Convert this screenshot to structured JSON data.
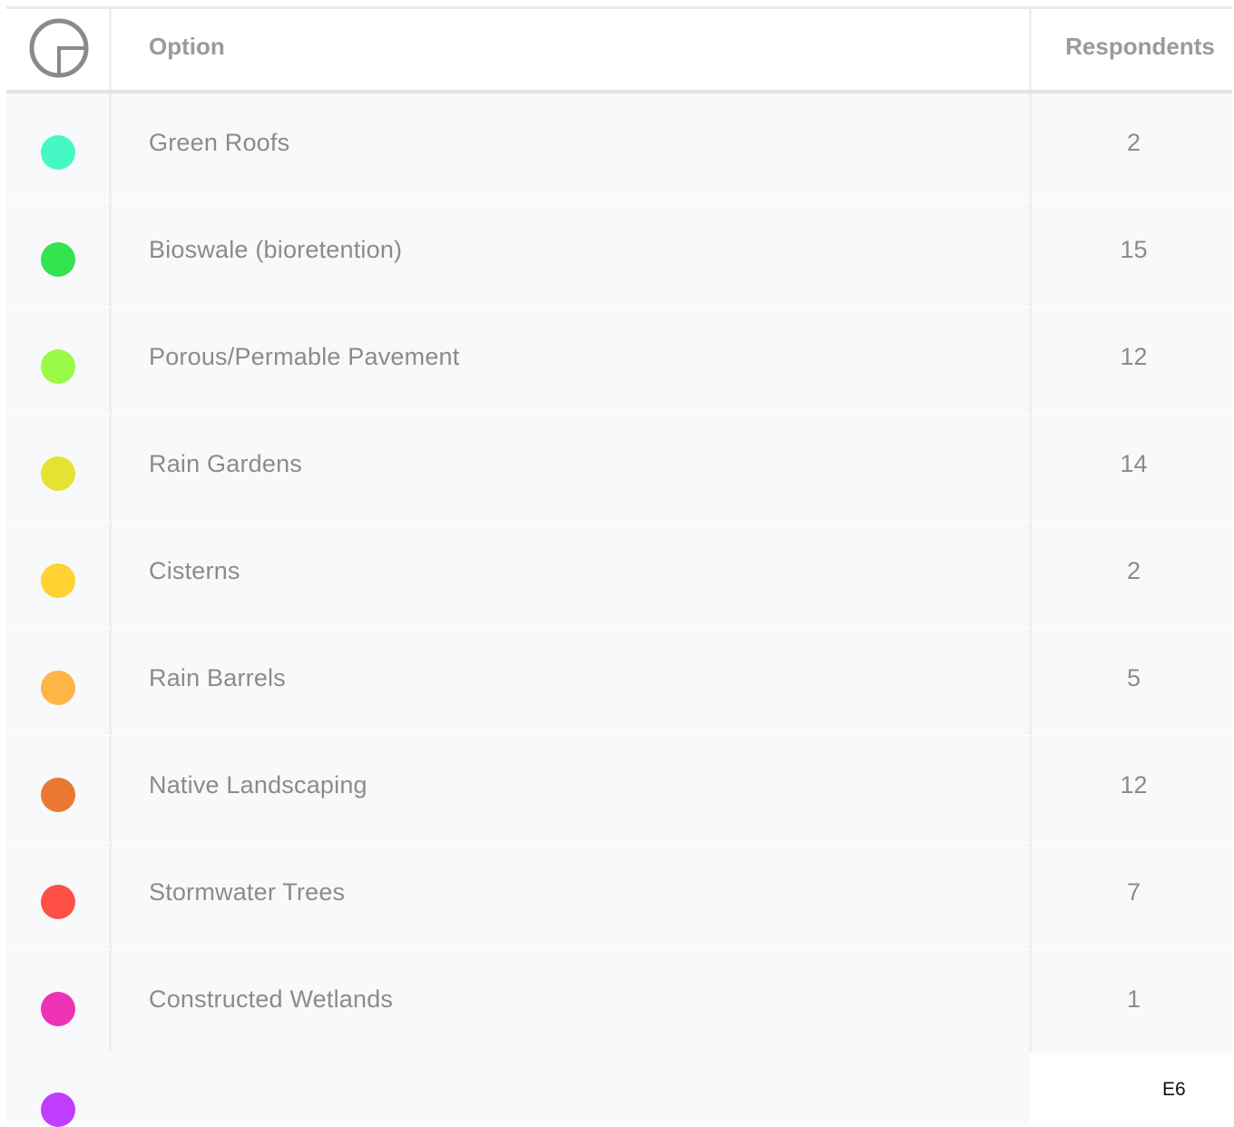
{
  "chart_data": {
    "type": "table",
    "columns": [
      "Option",
      "Respondents"
    ],
    "rows": [
      {
        "option": "Green Roofs",
        "respondents": 2,
        "color": "#45f8c4"
      },
      {
        "option": "Bioswale (bioretention)",
        "respondents": 15,
        "color": "#33e34f"
      },
      {
        "option": "Porous/Permable Pavement",
        "respondents": 12,
        "color": "#9afa48"
      },
      {
        "option": "Rain Gardens",
        "respondents": 14,
        "color": "#e6e232"
      },
      {
        "option": "Cisterns",
        "respondents": 2,
        "color": "#ffd232"
      },
      {
        "option": "Rain Barrels",
        "respondents": 5,
        "color": "#ffb446"
      },
      {
        "option": "Native Landscaping",
        "respondents": 12,
        "color": "#ea7832"
      },
      {
        "option": "Stormwater Trees",
        "respondents": 7,
        "color": "#ff5046"
      },
      {
        "option": "Constructed Wetlands",
        "respondents": 1,
        "color": "#ee32b4"
      }
    ],
    "partial_row": {
      "color": "#c03cff"
    }
  },
  "header": {
    "icon": "pie-chart-icon",
    "option_label": "Option",
    "respondents_label": "Respondents"
  },
  "cell_reference": "E6"
}
